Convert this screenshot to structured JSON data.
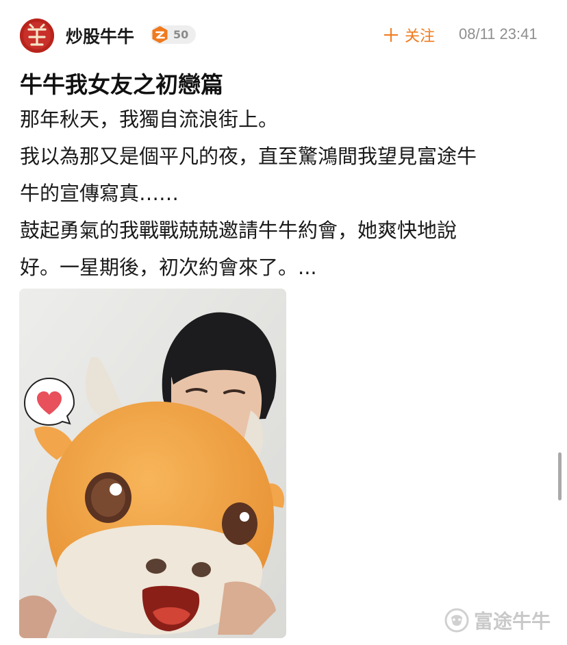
{
  "post": {
    "author": "炒股牛牛",
    "level": "50",
    "follow_label": "关注",
    "timestamp": "08/11 23:41",
    "title": "牛牛我女友之初戀篇",
    "body_lines": [
      "那年秋天，我獨自流浪街上。",
      "我以為那又是個平凡的夜，直至驚鴻間我望見富途牛",
      "牛的宣傳寫真……",
      "鼓起勇氣的我戰戰兢兢邀請牛牛約會，她爽快地說",
      "好。一星期後，初次約會來了。..."
    ]
  },
  "watermark": {
    "text": "富途牛牛"
  },
  "icons": {
    "avatar": "avatar-icon",
    "level": "level-badge-icon",
    "follow": "plus-icon",
    "speech_heart": "heart-speech-bubble-icon",
    "watermark": "futu-logo-icon"
  },
  "colors": {
    "accent": "#f07a1e",
    "level_badge": "#f07a1e",
    "avatar_bg": "#b8241c",
    "heart": "#e8505b"
  }
}
